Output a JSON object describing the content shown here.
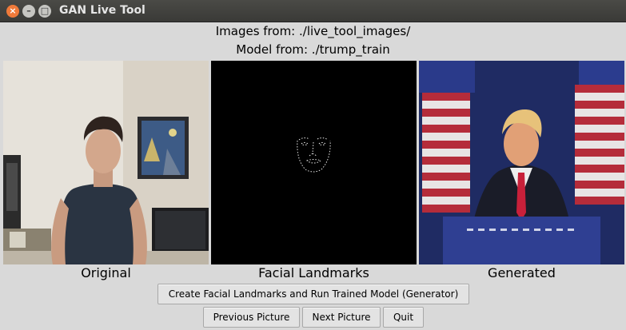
{
  "window": {
    "title": "GAN Live Tool",
    "controls": [
      "close-icon",
      "minimize-icon",
      "maximize-icon"
    ]
  },
  "header": {
    "images_from": "Images from: ./live_tool_images/",
    "model_from": "Model from: ./trump_train"
  },
  "panels": [
    {
      "label": "Original"
    },
    {
      "label": "Facial Landmarks"
    },
    {
      "label": "Generated"
    }
  ],
  "buttons": {
    "run": "Create Facial Landmarks and Run Trained Model (Generator)",
    "previous": "Previous Picture",
    "next": "Next Picture",
    "quit": "Quit"
  }
}
